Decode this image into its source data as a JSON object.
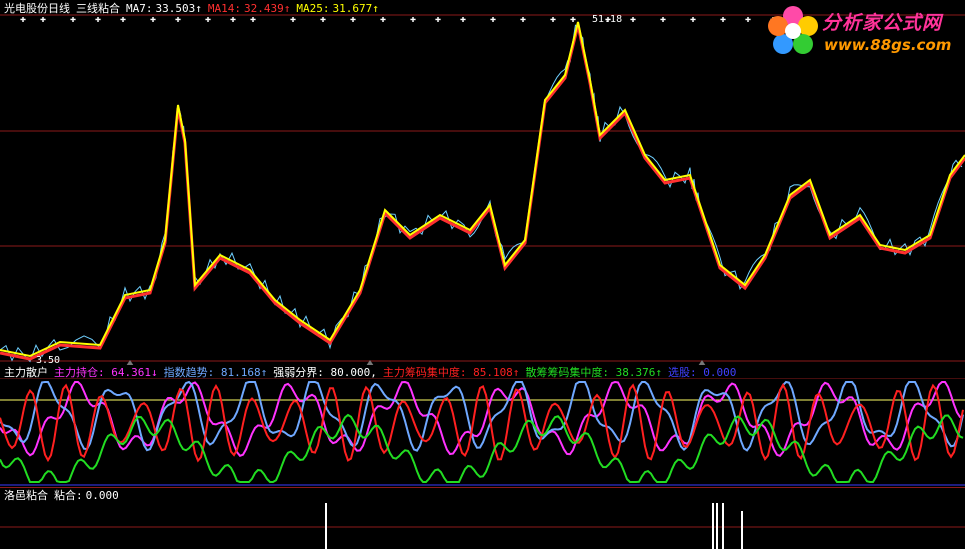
{
  "colors": {
    "background": "#000000",
    "frame": "#8b1a1a",
    "close": "#ffffff",
    "ma7": "#ffffff",
    "ma14": "#ff3030",
    "ma25": "#ffff00",
    "main_hold": "#ff2020",
    "index_trend": "#6fa8ff",
    "strong_weak": "#ffff66",
    "main_conc": "#ff2020",
    "retail_conc": "#22dd22",
    "select": "#2a2aff",
    "magenta": "#ff33ff"
  },
  "top_panel": {
    "title": "光电股份日线",
    "indicator": "三线粘合",
    "ma7": {
      "label": "MA7:",
      "value": "33.503",
      "arrow": "↑"
    },
    "ma14": {
      "label": "MA14:",
      "value": "32.439",
      "arrow": "↑"
    },
    "ma25": {
      "label": "MA25:",
      "value": "31.677",
      "arrow": "↑"
    },
    "high_label": "51.18",
    "low_label": "3.50",
    "price_y_range": [
      3.5,
      51.18
    ]
  },
  "mid_panel": {
    "title": "主力散户",
    "items": [
      {
        "label": "主力持仓:",
        "value": "64.361",
        "arrow": "↓",
        "color": "#ff33ff"
      },
      {
        "label": "指数趋势:",
        "value": "81.168",
        "arrow": "↑",
        "color": "#6fa8ff"
      },
      {
        "label": "强弱分界:",
        "value": "80.000,",
        "arrow": "",
        "color": "#ffffff"
      },
      {
        "label": "主力筹码集中度:",
        "value": "85.108",
        "arrow": "↑",
        "color": "#ff2020"
      },
      {
        "label": "散筹筹码集中度:",
        "value": "38.376",
        "arrow": "↑",
        "color": "#22dd22"
      },
      {
        "label": "选股:",
        "value": "0.000",
        "arrow": "",
        "color": "#4040ff"
      }
    ]
  },
  "bottom_panel": {
    "title": "洛邑粘合",
    "label": "粘合:",
    "value": "0.000"
  },
  "watermark": {
    "brand": "分析家公式网",
    "url": "www.88gs.com"
  }
}
